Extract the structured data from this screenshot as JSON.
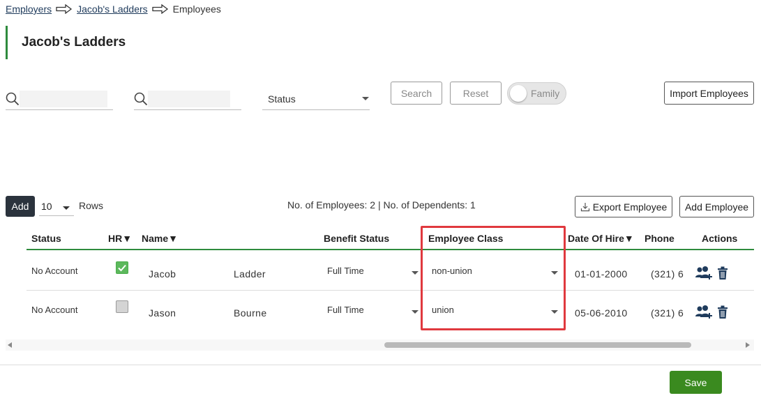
{
  "breadcrumb": {
    "items": [
      "Employers",
      "Jacob's Ladders"
    ],
    "current": "Employees"
  },
  "page": {
    "title": "Jacob's Ladders"
  },
  "filters": {
    "status_placeholder": "Status",
    "search_label": "Search",
    "reset_label": "Reset",
    "family_label": "Family",
    "import_label": "Import Employees"
  },
  "table_controls": {
    "add_label": "Add",
    "rows_value": "10",
    "rows_label": "Rows",
    "counts": "No. of Employees: 2 | No. of Dependents: 1",
    "export_label": "Export Employee",
    "add_employee_label": "Add Employee"
  },
  "table": {
    "headers": {
      "status": "Status",
      "hr": "HR▼",
      "name": "Name▼",
      "benefit_status": "Benefit Status",
      "employee_class": "Employee Class",
      "date_of_hire": "Date Of Hire▼",
      "phone": "Phone",
      "actions": "Actions"
    },
    "rows": [
      {
        "status": "No Account",
        "hr": true,
        "first": "Jacob",
        "last": "Ladder",
        "benefit": "Full Time",
        "class": "non-union",
        "hire": "01-01-2000",
        "phone": "(321) 6"
      },
      {
        "status": "No Account",
        "hr": false,
        "first": "Jason",
        "last": "Bourne",
        "benefit": "Full Time",
        "class": "union",
        "hire": "05-06-2010",
        "phone": "(321) 6"
      }
    ]
  },
  "footer": {
    "save_label": "Save"
  },
  "colors": {
    "accent_green": "#2e8b3d",
    "save_green": "#3a8a1f",
    "highlight_red": "#e0393e",
    "add_dark": "#2b333d"
  }
}
